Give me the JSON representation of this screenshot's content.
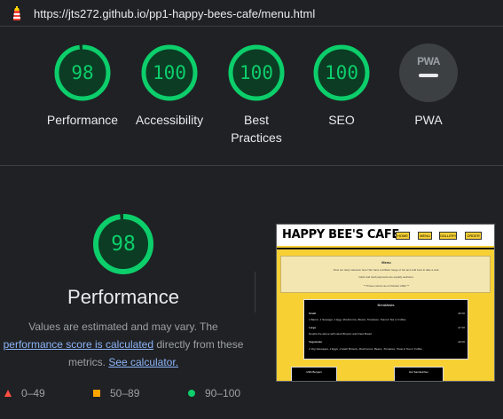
{
  "url_bar": {
    "url": "https://jts272.github.io/pp1-happy-bees-cafe/menu.html",
    "favicon": "lighthouse-icon"
  },
  "categories": [
    {
      "score": "98",
      "label": "Performance",
      "fraction": 0.98
    },
    {
      "score": "100",
      "label": "Accessibility",
      "fraction": 1.0
    },
    {
      "score": "100",
      "label": "Best Practices",
      "fraction": 1.0
    },
    {
      "score": "100",
      "label": "SEO",
      "fraction": 1.0
    },
    {
      "score": "PWA",
      "label": "PWA",
      "fraction": null
    }
  ],
  "performance": {
    "score": "98",
    "fraction": 0.98,
    "title": "Performance",
    "desc_prefix": "Values are estimated and may vary. The",
    "score_link": "performance score is calculated",
    "desc_middle": "directly from these metrics.",
    "calc_link": "See calculator."
  },
  "legend": [
    {
      "range": "0–49",
      "shape": "triangle",
      "color": "#ff4e42"
    },
    {
      "range": "50–89",
      "shape": "square",
      "color": "#ffa400"
    },
    {
      "range": "90–100",
      "shape": "circle",
      "color": "#0cce6b"
    }
  ],
  "thumbnail": {
    "site_title": "HAPPY BEE'S CAFE",
    "nav": [
      "HOME",
      "MENU",
      "GALLERY",
      "ORDER"
    ],
    "menu_title": "Menu",
    "menu_lines": [
      "View our tasty selection here! We have a brilliant range of hot and cold food to take a look.",
      "Cash and card payments are equally welcome.",
      "** Prices correct as of October 2022 **"
    ],
    "card_title": "Breakfasts",
    "card_rows": [
      {
        "name": "Small",
        "price": "£6.00"
      },
      {
        "name": "1 Bacon, 1 Sausage, 1 Egg, Mushrooms, Beans, Tomatoes, Toast & Tea or Coffee",
        "price": ""
      },
      {
        "name": "Large",
        "price": "£7.00"
      },
      {
        "name": "Double the above with Hash Browns and Fried Bread",
        "price": ""
      },
      {
        "name": "Vegetarian",
        "price": "£6.00"
      },
      {
        "name": "2 Veg Sausages, 2 Eggs, 2 Hash Browns, Mushrooms, Beans, Tomatoes, Toast & Tea or Coffee",
        "price": ""
      }
    ],
    "small_cards": [
      "1/4lb Burgers",
      "Hot Sandwiches"
    ]
  },
  "colors": {
    "pass": "#0cce6b",
    "pass_bg": "#0c3c24",
    "link": "#8ab4f8",
    "thumb_yellow": "#f7d034"
  }
}
